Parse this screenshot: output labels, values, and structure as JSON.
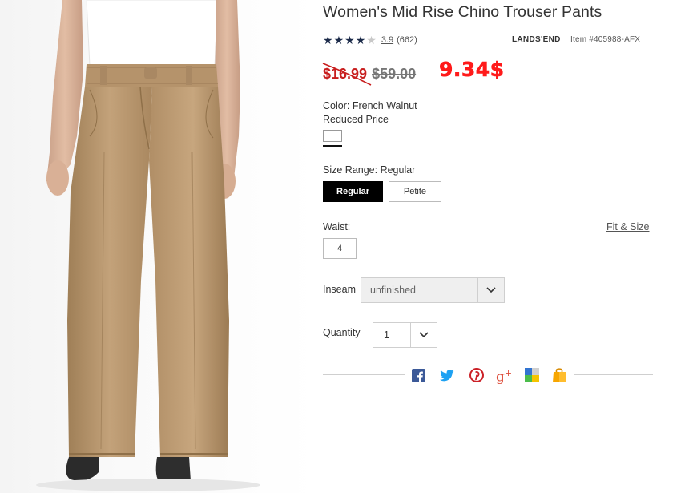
{
  "product": {
    "title": "Women's Mid Rise Chino Trouser Pants",
    "rating_value": "3.9",
    "review_count": "(662)",
    "rating_stars": 3.9,
    "brand": "LANDS'END",
    "item_number": "Item #405988-AFX"
  },
  "price": {
    "sale": "$16.99",
    "original": "$59.00",
    "new": "9.34$"
  },
  "options": {
    "color_label": "Color: French Walnut",
    "price_type": "Reduced Price",
    "size_range_label": "Size Range: Regular",
    "size_ranges": [
      "Regular",
      "Petite"
    ],
    "waist_label": "Waist:",
    "waist_value": "4",
    "fit_size_link": "Fit & Size",
    "inseam_label": "Inseam",
    "inseam_value": "unfinished",
    "quantity_label": "Quantity",
    "quantity_value": "1"
  },
  "share": {
    "icons": [
      "facebook-icon",
      "twitter-icon",
      "pinterest-icon",
      "google-plus-icon",
      "delicious-icon",
      "shopping-bag-icon"
    ]
  },
  "colors": {
    "sale_red": "#c81e1e",
    "new_price_red": "#ff1a1a",
    "star_navy": "#1c2b4a",
    "khaki": "#b9976d"
  }
}
